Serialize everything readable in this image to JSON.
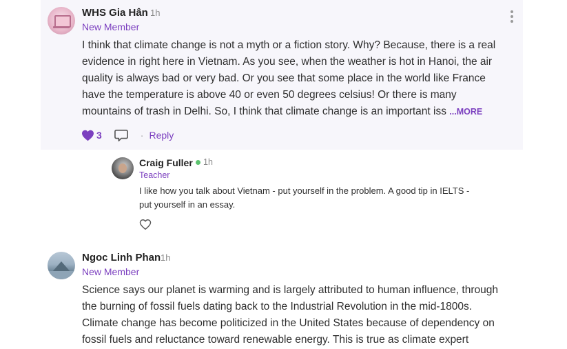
{
  "posts": [
    {
      "author": "WHS Gia Hân",
      "time": "1h",
      "role": "New Member",
      "body_lines": [
        "I think that climate change is not a myth or a fiction story. Why? Because, there is a real",
        "evidence in right here in Vietnam. As you see, when the weather is hot in Hanoi, the air",
        "quality is always bad or very bad. Or you see that some place in the world like France",
        "have the temperature is above 40 or even 50 degrees celsius! Or there is many",
        "mountains of trash in Delhi. So, I think that climate change is an important iss"
      ],
      "more_label": "...MORE",
      "like_count": "3",
      "reply_label": "Reply",
      "separator": "·",
      "avatar_icon": "laptop-avatar",
      "menu_icon": "kebab-menu-icon"
    },
    {
      "author": "Ngoc Linh Phan",
      "time": "1h",
      "role": "New Member",
      "body_lines": [
        "Science says our planet is warming and is largely attributed to human influence, through",
        "the burning of fossil fuels dating back to the Industrial Revolution in the mid-1800s.",
        "Climate change has become politicized in the United States because of dependency on",
        "fossil fuels and reluctance toward renewable energy. This is true as climate expert"
      ],
      "avatar_icon": "landscape-avatar"
    }
  ],
  "reply": {
    "author": "Craig Fuller",
    "time": "1h",
    "role": "Teacher",
    "online": true,
    "body_lines": [
      "I like how you talk about Vietnam - put yourself in the problem. A good tip in IELTS -",
      "put yourself in an essay."
    ],
    "like_icon": "heart-outline-icon"
  },
  "colors": {
    "accent": "#7b3fbf",
    "highlight_bg": "#f7f6fb",
    "online": "#5cc36f",
    "muted": "#8a8a8a"
  }
}
